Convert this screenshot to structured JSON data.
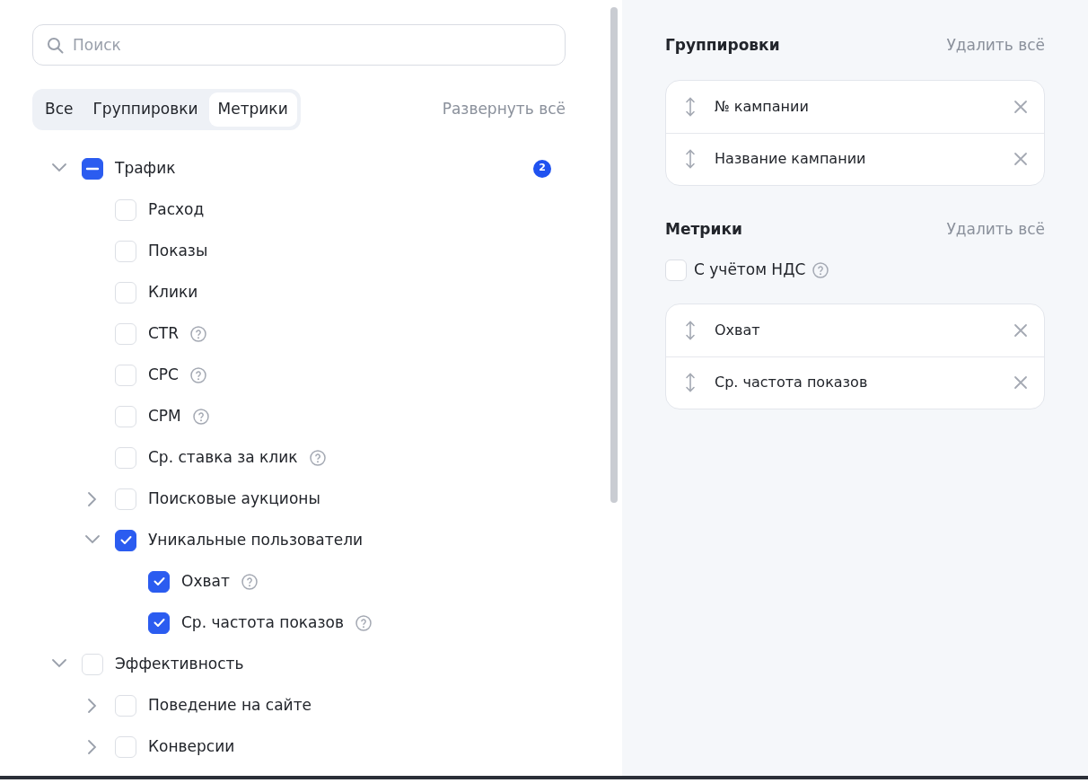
{
  "search": {
    "placeholder": "Поиск"
  },
  "tabs": [
    {
      "label": "Все",
      "selected": false
    },
    {
      "label": "Группировки",
      "selected": false
    },
    {
      "label": "Метрики",
      "selected": true
    }
  ],
  "expand_all": "Развернуть всё",
  "tree": [
    {
      "label": "Трафик",
      "mixed": true,
      "expanded": true,
      "badge": "2",
      "children": [
        {
          "label": "Расход",
          "checked": false
        },
        {
          "label": "Показы",
          "checked": false
        },
        {
          "label": "Клики",
          "checked": false
        },
        {
          "label": "CTR",
          "checked": false,
          "help": true
        },
        {
          "label": "CPC",
          "checked": false,
          "help": true
        },
        {
          "label": "CPM",
          "checked": false,
          "help": true
        },
        {
          "label": "Ср. ставка за клик",
          "checked": false,
          "help": true
        },
        {
          "label": "Поисковые аукционы",
          "checked": false,
          "expanded": false
        },
        {
          "label": "Уникальные пользователи",
          "checked": true,
          "expanded": true,
          "children": [
            {
              "label": "Охват",
              "checked": true,
              "help": true
            },
            {
              "label": "Ср. частота показов",
              "checked": true,
              "help": true
            }
          ]
        }
      ]
    },
    {
      "label": "Эффективность",
      "checked": false,
      "expanded": true,
      "children": [
        {
          "label": "Поведение на сайте",
          "checked": false,
          "expanded": false
        },
        {
          "label": "Конверсии",
          "checked": false,
          "expanded": false
        }
      ]
    }
  ],
  "groupings": {
    "title": "Группировки",
    "clear": "Удалить всё",
    "items": [
      "№ кампании",
      "Название кампании"
    ]
  },
  "metrics": {
    "title": "Метрики",
    "clear": "Удалить всё",
    "vat": {
      "label": "С учётом НДС",
      "checked": false,
      "help": true
    },
    "items": [
      "Охват",
      "Ср. частота показов"
    ]
  }
}
